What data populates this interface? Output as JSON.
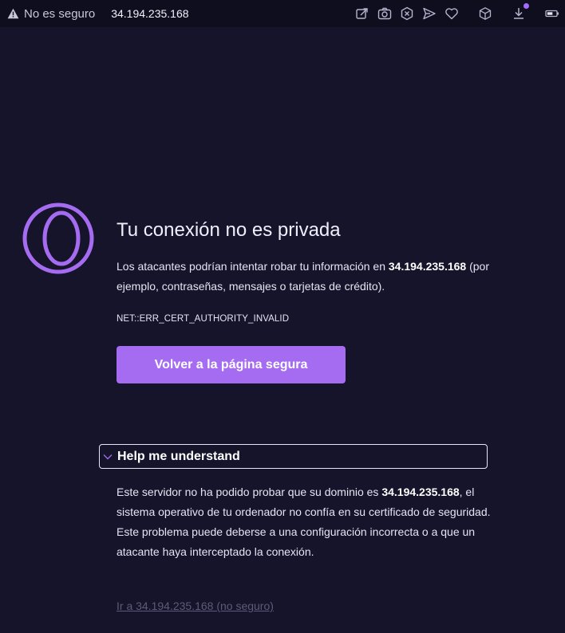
{
  "browser": {
    "security_label": "No es seguro",
    "url": "34.194.235.168",
    "icons": [
      "warning-icon",
      "share-icon",
      "camera-icon",
      "close-x-icon",
      "send-icon",
      "heart-icon",
      "box-icon",
      "download-icon",
      "battery-icon"
    ],
    "accent_color": "#a56cf2"
  },
  "page": {
    "title": "Tu conexión no es privada",
    "desc_part1": "Los atacantes podrían intentar robar tu información en ",
    "desc_host": "34.194.235.168",
    "desc_part2": " (por ejemplo, contraseñas, mensajes o tarjetas de crédito).",
    "error_code": "NET::ERR_CERT_AUTHORITY_INVALID",
    "back_button": "Volver a la página segura",
    "details_label": "Help me understand",
    "explain_part1": "Este servidor no ha podido probar que su dominio es ",
    "explain_host": "34.194.235.168",
    "explain_part2": ", el sistema operativo de tu ordenador no confía en su certificado de seguridad. Este problema puede deberse a una configuración incorrecta o a que un atacante haya interceptado la conexión.",
    "proceed_link": "Ir a 34.194.235.168 (no seguro)"
  }
}
